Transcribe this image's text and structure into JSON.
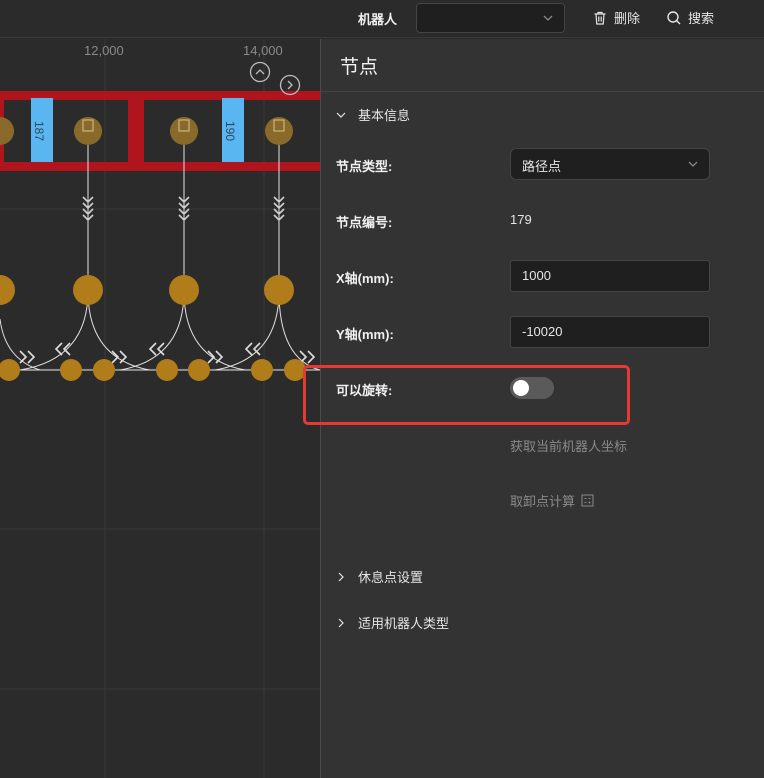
{
  "topbar": {
    "robot_label": "机器人",
    "robot_select_value": "",
    "delete_label": "删除",
    "search_label": "搜索"
  },
  "canvas": {
    "ruler_labels": [
      "12,000",
      "14,000"
    ],
    "station_labels": [
      "187",
      "190"
    ],
    "colors": {
      "rack": "#b0141c",
      "station": "#5ab6f0",
      "node": "#b07d1a"
    }
  },
  "panel": {
    "title": "节点",
    "basic_section": "基本信息",
    "node_type_label": "节点类型:",
    "node_type_value": "路径点",
    "node_id_label": "节点编号:",
    "node_id_value": "179",
    "x_label": "X轴(mm):",
    "x_value": "1000",
    "y_label": "Y轴(mm):",
    "y_value": "-10020",
    "rotate_label": "可以旋转:",
    "rotate_on": false,
    "get_coords_label": "获取当前机器人坐标",
    "unload_calc_label": "取卸点计算",
    "rest_section": "休息点设置",
    "robot_type_section": "适用机器人类型"
  }
}
